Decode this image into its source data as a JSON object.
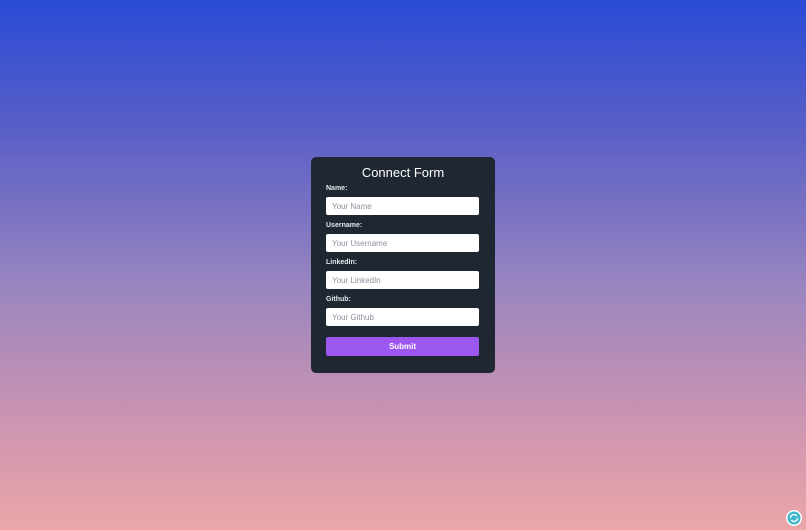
{
  "form": {
    "title": "Connect Form",
    "fields": [
      {
        "label": "Name:",
        "placeholder": "Your Name"
      },
      {
        "label": "Username:",
        "placeholder": "Your Username"
      },
      {
        "label": "LinkedIn:",
        "placeholder": "Your LinkedIn"
      },
      {
        "label": "Github:",
        "placeholder": "Your Github"
      }
    ],
    "submit_label": "Submit"
  },
  "colors": {
    "card_bg": "#1f2733",
    "button_bg": "#9b57f0",
    "gradient_top": "#2a4bd6",
    "gradient_bottom": "#eca6a8"
  },
  "icons": {
    "corner": "refresh-icon"
  }
}
